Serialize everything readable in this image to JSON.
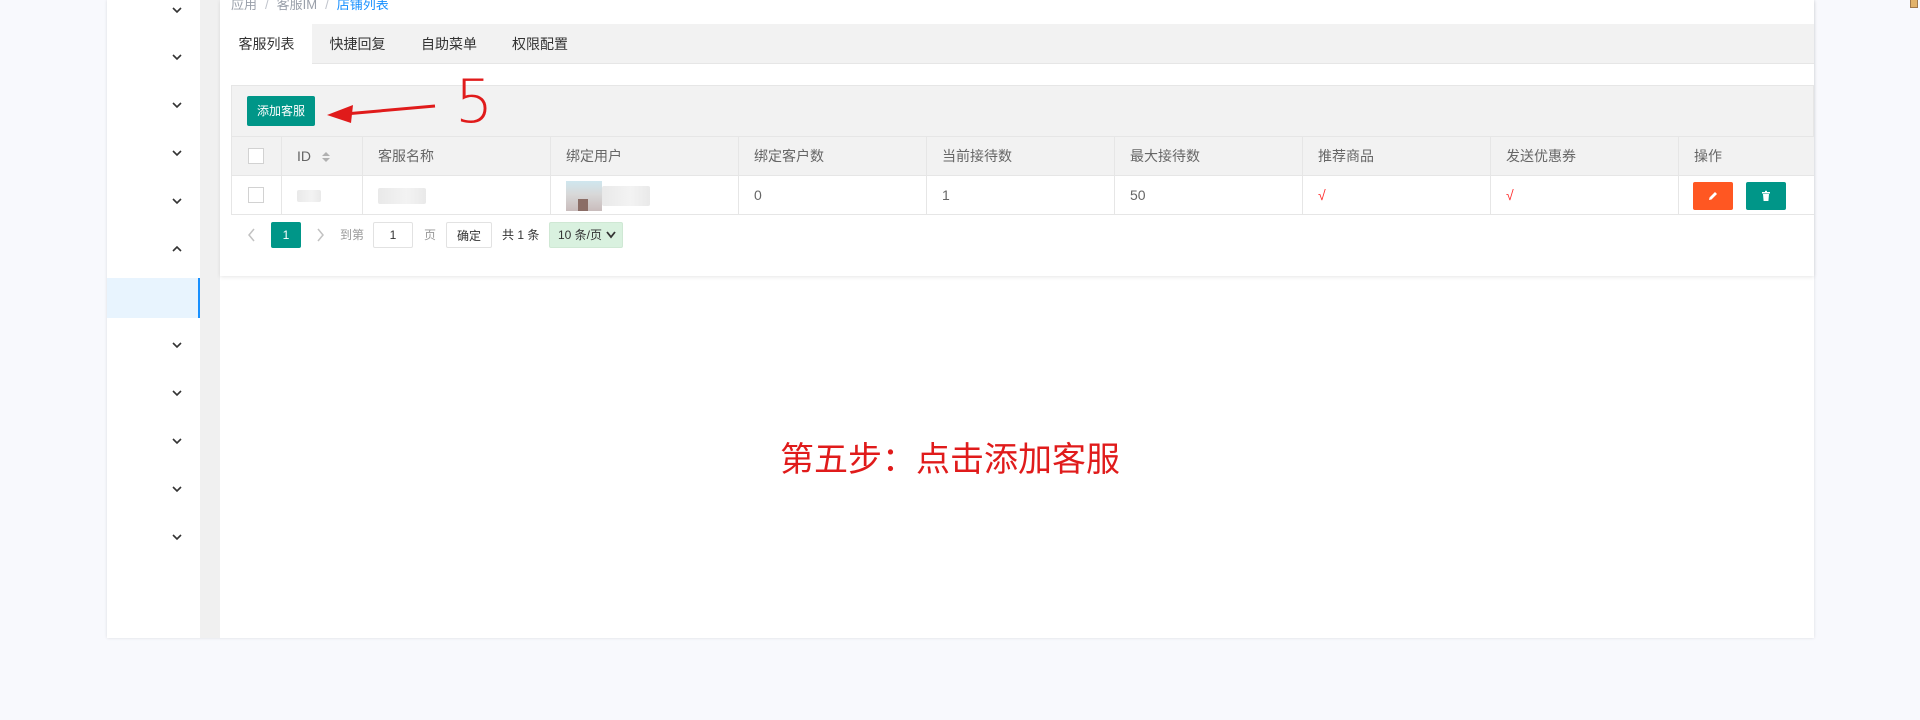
{
  "breadcrumb": {
    "items": [
      "应用",
      "客服IM",
      "店铺列表"
    ]
  },
  "tabs": [
    {
      "label": "客服列表",
      "active": true
    },
    {
      "label": "快捷回复",
      "active": false
    },
    {
      "label": "自助菜单",
      "active": false
    },
    {
      "label": "权限配置",
      "active": false
    }
  ],
  "toolbar": {
    "add_label": "添加客服"
  },
  "annotation": {
    "step_number": "5",
    "step_text": "第五步：点击添加客服",
    "color": "#e01b1b"
  },
  "table": {
    "headers": [
      "ID",
      "客服名称",
      "绑定用户",
      "绑定客户数",
      "当前接待数",
      "最大接待数",
      "推荐商品",
      "发送优惠券",
      "操作"
    ],
    "rows": [
      {
        "bind_customers": "0",
        "current_reception": "1",
        "max_reception": "50",
        "recommend": "√",
        "coupon": "√"
      }
    ]
  },
  "pager": {
    "current_page": "1",
    "goto_label": "到第",
    "page_input": "1",
    "page_suffix": "页",
    "ok_label": "确定",
    "total_label": "共 1 条",
    "limit_label": "10 条/页"
  },
  "colors": {
    "primary": "#009688",
    "warn": "#ff5722",
    "link": "#1890ff"
  }
}
